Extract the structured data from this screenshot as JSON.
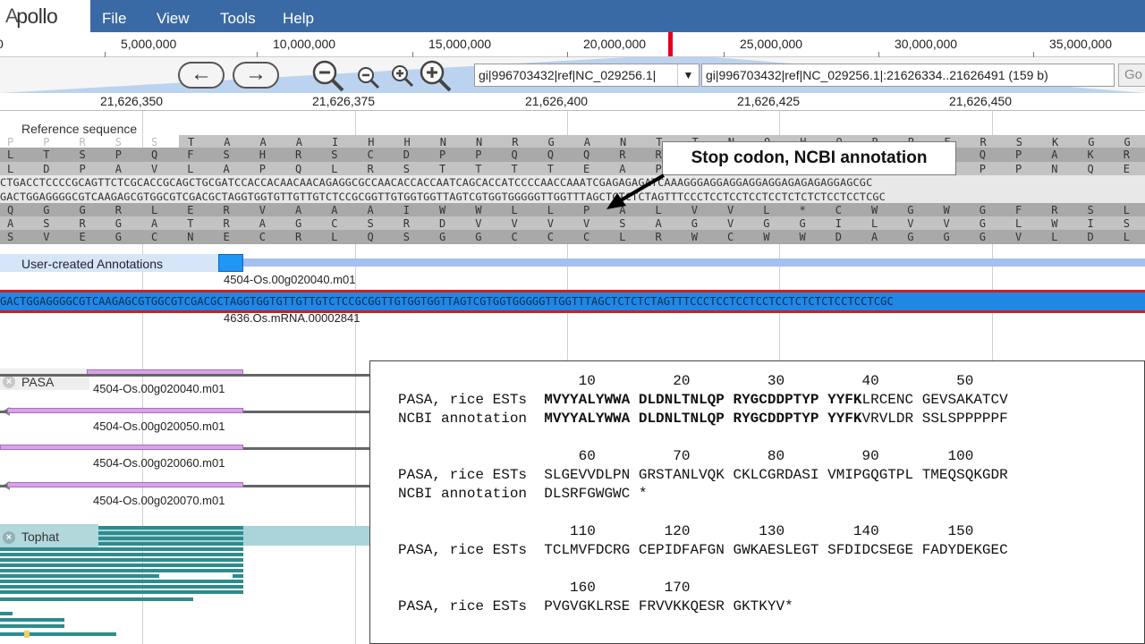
{
  "app": {
    "logo_text": "pollo",
    "logo_glyph": "A"
  },
  "menu": {
    "items": [
      "File",
      "View",
      "Tools",
      "Help"
    ]
  },
  "overview": {
    "ticks": [
      "0",
      "5,000,000",
      "10,000,000",
      "15,000,000",
      "20,000,000",
      "25,000,000",
      "30,000,000",
      "35,000,000"
    ]
  },
  "toolbar": {
    "back_icon": "arrow-left-icon",
    "forward_icon": "arrow-right-icon",
    "zoom_out_big_icon": "zoom-out-icon",
    "zoom_out_icon": "zoom-out-small-icon",
    "zoom_in_icon": "zoom-in-small-icon",
    "zoom_in_big_icon": "zoom-in-icon",
    "ref_select_value": "gi|996703432|ref|NC_029256.1|",
    "location_value": "gi|996703432|ref|NC_029256.1|:21626334..21626491 (159 b)",
    "go_label": "Go"
  },
  "ruler": {
    "ticks": [
      "21,626,350",
      "21,626,375",
      "21,626,400",
      "21,626,425",
      "21,626,450"
    ]
  },
  "reference": {
    "label": "Reference sequence",
    "ghost": "P P R S S R",
    "rows": [
      "T A A A I H H N N R G A N T T N Q H Q R R F R S K G G G G G E R E E R",
      "L T S P Q F S H R S C D P P Q Q Q R R Q H H Q S A P P Q P A K R R E E R R R E R G A",
      "L D P A V L A P Q L R S T T T T E A P T P P I S T P P P P N Q E E R R E E E R S D",
      "CTGACCTCCCCGCAGTTCTCGCACCGCAGCTGCGATCCACCACAACAACAGAGGCGCCAACACCACCAATCAGCACCATCCCCAACCAAATCGAGAGAGATCAAAGGGAGGAGGAGGAGGAGAGAGAGGAGCGC",
      "GACTGGAGGGGCGTCAAGAGCGTGGCGTCGACGCTAGGTGGTGTTGTTGTCTCCGCGGTTGTGGTGGTTAGTCGTGGTGGGGGTTGGTTTAGCTCTCTCTAGTTTCCCTCCTCCTCCTCCTCTCTCTCCTCCTCGC",
      "Q G G R L E R V A A A I W W L L P A L V V L * C W G W G F R S L D F P P P P P S L S R",
      "A S R G A T R A G C S R D V V V V S A G V G G I L V V G L W I S L S * L S S S S S L S L",
      "S V E G C N E C R L Q S G G C C C L R W C W W D A G G G V L D L S I L P L L L L S L P A"
    ],
    "callout": "Stop codon, NCBI annotation"
  },
  "annotations": {
    "label": "User-created Annotations",
    "feature1": "4504-Os.00g020040.m01",
    "selected_seq": "GACTGGAGGGGCGTCAAGAGCGTGGCGTCGACGCTAGGTGGTGTTGTTGTCTCCGCGGTTGTGGTGGTTAGTCGTGGTGGGGGTTGGTTTAGCTCTCTCTAGTTTCCCTCCTCCTCCTCCTCTCTCTCCTCCTCGC",
    "feature2": "4636.Os.mRNA.00002841"
  },
  "pasa": {
    "label": "PASA",
    "features": [
      "4504-Os.00g020040.m01",
      "4504-Os.00g020050.m01",
      "4504-Os.00g020060.m01",
      "4504-Os.00g020070.m01"
    ]
  },
  "tophat": {
    "label": "Tophat"
  },
  "alignment": {
    "blocks": [
      {
        "numbers": "                     10         20         30         40         50",
        "rows": [
          {
            "label": "PASA, rice ESTs  ",
            "bold": "MVYYALYWWA DLDNLTNLQP RYGCDDPTYP YYFK",
            "rest": "LRCENC GEVSAKATCV"
          },
          {
            "label": "NCBI annotation  ",
            "bold": "MVYYALYWWA DLDNLTNLQP RYGCDDPTYP YYFK",
            "rest": "VRVLDR SSLSPPPPPF"
          }
        ]
      },
      {
        "numbers": "                     60         70         80         90        100",
        "rows": [
          {
            "label": "PASA, rice ESTs  ",
            "bold": "",
            "rest": "SLGEVVDLPN GRSTANLVQK CKLCGRDASI VMIPGQGTPL TMEQSQKGDR"
          },
          {
            "label": "NCBI annotation  ",
            "bold": "",
            "rest": "DLSRFGWGWC *"
          }
        ]
      },
      {
        "numbers": "                    110        120        130        140        150",
        "rows": [
          {
            "label": "PASA, rice ESTs  ",
            "bold": "",
            "rest": "TCLMVFDCRG CEPIDFAFGN GWKAESLEGT SFDIDCSEGE FADYDEKGEC"
          }
        ]
      },
      {
        "numbers": "                    160        170",
        "rows": [
          {
            "label": "PASA, rice ESTs  ",
            "bold": "",
            "rest": "PVGVGKLRSE FRVVKKQESR GKTKYV*"
          }
        ]
      }
    ]
  },
  "colors": {
    "menubar": "#3a6aa5",
    "selected_border": "#cd1f1f",
    "selected_fill": "#1e88e5",
    "pasa_feature": "#d7a3e9",
    "tophat": "#2d8c8c",
    "overview_marker": "#e3001b"
  }
}
